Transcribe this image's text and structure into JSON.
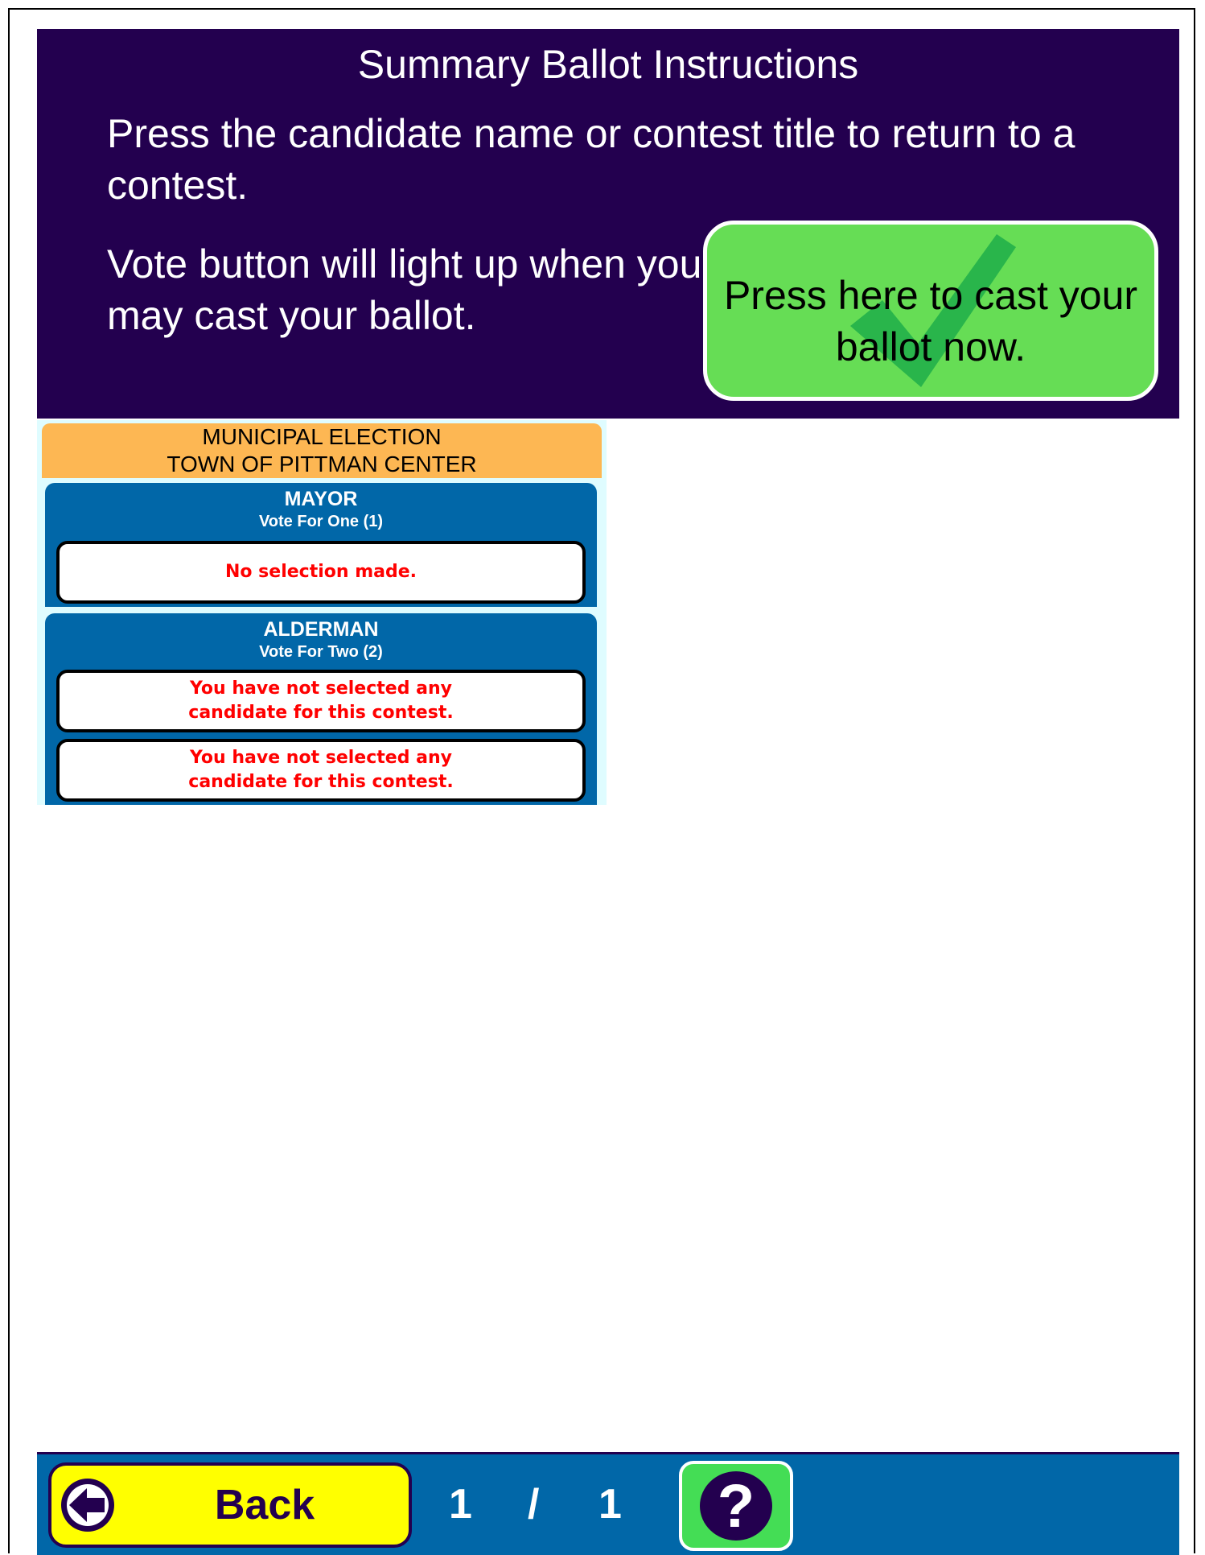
{
  "header": {
    "title": "Summary Ballot Instructions",
    "instruction_return": "Press the candidate name or contest title to return to a contest.",
    "instruction_vote": "Vote button will light up when you may cast your ballot.",
    "cast_button_label": "Press here to cast your ballot now."
  },
  "ballot": {
    "election_line1": "MUNICIPAL ELECTION",
    "election_line2": "TOWN OF PITTMAN CENTER",
    "contests": [
      {
        "title": "MAYOR",
        "vote_for": "Vote For One (1)",
        "selections": [
          "No selection made."
        ]
      },
      {
        "title": "ALDERMAN",
        "vote_for": "Vote For Two (2)",
        "selections": [
          "You have not selected any\n candidate for this contest.",
          "You have not selected any\n candidate for this contest."
        ]
      }
    ]
  },
  "footer": {
    "back_label": "Back",
    "page_current": "1",
    "page_separator": "/",
    "page_total": "1",
    "back_icon": "arrow-left-circle-icon",
    "help_icon": "question-circle-icon"
  },
  "colors": {
    "header_bg": "#23004f",
    "cast_button": "#66dd55",
    "election_header": "#fdb753",
    "contest_bg": "#0167a8",
    "error_text": "#ff0000",
    "back_button": "#ffff00"
  }
}
